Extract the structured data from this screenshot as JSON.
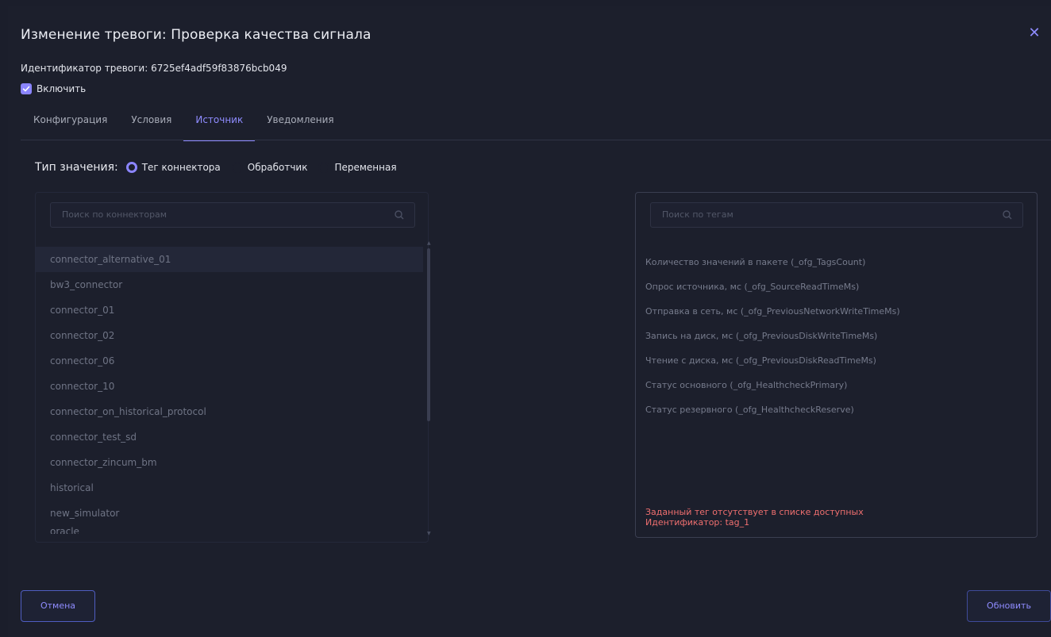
{
  "dialog": {
    "title": "Изменение тревоги: Проверка качества сигнала",
    "close_icon": "close-icon",
    "alarm_id": "Идентификатор тревоги: 6725ef4adf59f83876bcb049",
    "enable_label": "Включить",
    "enable_checked": true
  },
  "tabs": [
    {
      "label": "Конфигурация",
      "active": false
    },
    {
      "label": "Условия",
      "active": false
    },
    {
      "label": "Источник",
      "active": true
    },
    {
      "label": "Уведомления",
      "active": false
    }
  ],
  "source": {
    "type_label": "Тип значения:",
    "options": [
      {
        "label": "Тег коннектора",
        "checked": true
      },
      {
        "label": "Обработчик",
        "checked": false
      },
      {
        "label": "Переменная",
        "checked": false
      }
    ],
    "connector_search_placeholder": "Поиск по коннекторам",
    "connectors": [
      "connector_alternative_01",
      "bw3_connector",
      "connector_01",
      "connector_02",
      "connector_06",
      "connector_10",
      "connector_on_historical_protocol",
      "connector_test_sd",
      "connector_zincum_bm",
      "historical",
      "new_simulator",
      "oracle"
    ],
    "tag_search_placeholder": "Поиск по тегам",
    "tags": [
      "Количество значений в пакете (_ofg_TagsCount)",
      "Опрос источника, мс (_ofg_SourceReadTimeMs)",
      "Отправка в сеть, мс (_ofg_PreviousNetworkWriteTimeMs)",
      "Запись на диск, мс (_ofg_PreviousDiskWriteTimeMs)",
      "Чтение с диска, мс (_ofg_PreviousDiskReadTimeMs)",
      "Статус основного (_ofg_HealthcheckPrimary)",
      "Статус резервного (_ofg_HealthcheckReserve)"
    ],
    "error_line1": "Заданный тег отсутствует в списке доступных",
    "error_line2": "Идентификатор: tag_1"
  },
  "footer": {
    "cancel_label": "Отмена",
    "update_label": "Обновить"
  },
  "colors": {
    "accent": "#8b85ff",
    "error": "#ef6f6f",
    "background": "#1c1f2c"
  }
}
